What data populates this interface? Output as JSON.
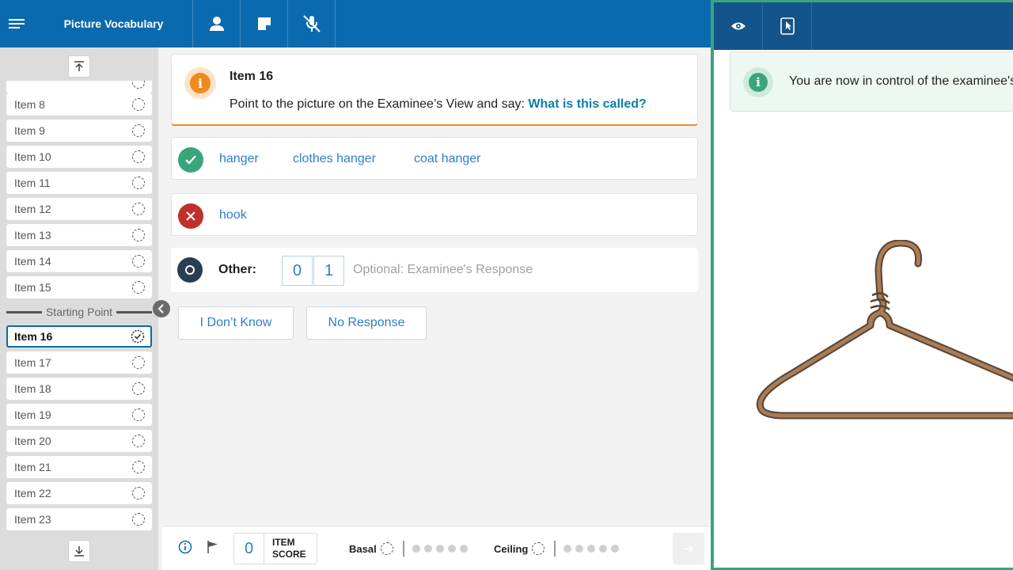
{
  "app": {
    "title": "Picture Vocabulary"
  },
  "sidebar": {
    "items": [
      {
        "label": "Item 8"
      },
      {
        "label": "Item 9"
      },
      {
        "label": "Item 10"
      },
      {
        "label": "Item 11"
      },
      {
        "label": "Item 12"
      },
      {
        "label": "Item 13"
      },
      {
        "label": "Item 14"
      },
      {
        "label": "Item 15"
      }
    ],
    "divider_label": "Starting Point",
    "items_after": [
      {
        "label": "Item 16",
        "active": true
      },
      {
        "label": "Item 17"
      },
      {
        "label": "Item 18"
      },
      {
        "label": "Item 19"
      },
      {
        "label": "Item 20"
      },
      {
        "label": "Item 21"
      },
      {
        "label": "Item 22"
      },
      {
        "label": "Item 23"
      }
    ]
  },
  "prompt": {
    "title": "Item 16",
    "instruction": "Point to the picture on the Examinee’s View and say: ",
    "question": "What is this called?"
  },
  "responses": {
    "correct": [
      "hanger",
      "clothes hanger",
      "coat hanger"
    ],
    "incorrect": [
      "hook"
    ],
    "other_label": "Other:",
    "score_options": [
      "0",
      "1"
    ],
    "other_placeholder": "Optional: Examinee's Response"
  },
  "actions": {
    "dont_know": "I Don’t Know",
    "no_response": "No Response"
  },
  "footer": {
    "item_score_value": "0",
    "item_score_label_1": "ITEM",
    "item_score_label_2": "SCORE",
    "basal_label": "Basal",
    "ceiling_label": "Ceiling"
  },
  "examinee_panel": {
    "notice": "You are now in control of the examinee's view"
  },
  "colors": {
    "primary": "#0b6aad",
    "accent_orange": "#f08a1f",
    "success": "#3aa57a",
    "error": "#c0302b",
    "link": "#2f7fc7"
  }
}
